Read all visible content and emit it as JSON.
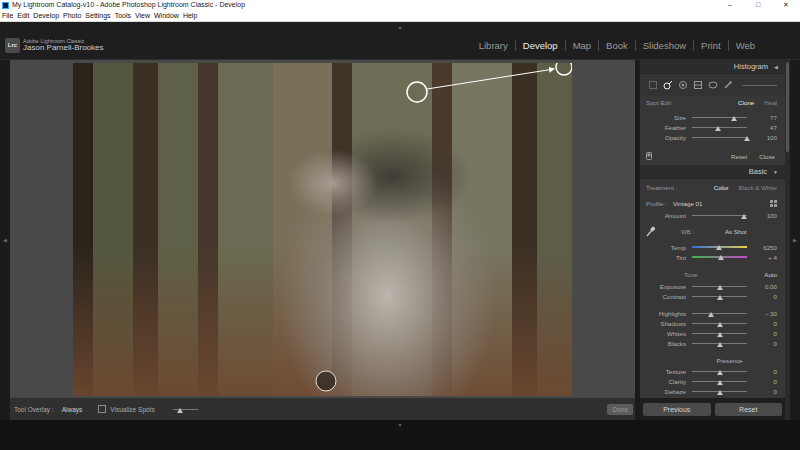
{
  "window": {
    "title": "My Lightroom Catalog-v10 - Adobe Photoshop Lightroom Classic - Develop",
    "controls": [
      "–",
      "□",
      "✕"
    ]
  },
  "menu": [
    "File",
    "Edit",
    "Develop",
    "Photo",
    "Settings",
    "Tools",
    "View",
    "Window",
    "Help"
  ],
  "identity": {
    "logo": "Lrc",
    "product": "Adobe Lightroom Classic",
    "user": "Jason Parnell-Brookes"
  },
  "modules": [
    {
      "label": "Library",
      "selected": false
    },
    {
      "label": "Develop",
      "selected": true
    },
    {
      "label": "Map",
      "selected": false
    },
    {
      "label": "Book",
      "selected": false
    },
    {
      "label": "Slideshow",
      "selected": false
    },
    {
      "label": "Print",
      "selected": false
    },
    {
      "label": "Web",
      "selected": false
    }
  ],
  "panel_toggles": {
    "top": "▲",
    "bottom": "▼",
    "left": "◀",
    "right": "▶"
  },
  "right_panel": {
    "histogram": {
      "title": "Histogram",
      "toggle": "◀"
    },
    "tools": [
      {
        "kind": "crop",
        "selected": false
      },
      {
        "kind": "spot",
        "selected": true
      },
      {
        "kind": "redeye",
        "selected": false
      },
      {
        "kind": "graduated",
        "selected": false
      },
      {
        "kind": "radial",
        "selected": false
      },
      {
        "kind": "brush",
        "selected": false
      }
    ],
    "spot_edit": {
      "label": "Spot Edit :",
      "modes": [
        {
          "label": "Clone",
          "selected": true
        },
        {
          "label": "Heal",
          "selected": false
        }
      ],
      "sliders": [
        {
          "label": "Size",
          "value": "77",
          "level": 0.77,
          "kind": "plain"
        },
        {
          "label": "Feather",
          "value": "47",
          "level": 0.47,
          "kind": "plain"
        },
        {
          "label": "Opacity",
          "value": "100",
          "level": 1.0,
          "kind": "plain"
        }
      ],
      "buttons": [
        "Reset",
        "Close"
      ]
    },
    "basic": {
      "title": "Basic",
      "toggle": "▼",
      "treatment": {
        "label": "Treatment :",
        "options": [
          {
            "label": "Color",
            "selected": true
          },
          {
            "label": "Black & White",
            "selected": false
          }
        ]
      },
      "profile": {
        "label": "Profile :",
        "value": "Vintage 01"
      },
      "amount": {
        "label": "Amount",
        "value": "100",
        "level": 0.95,
        "kind": "plain"
      },
      "wb": {
        "label": "WB :",
        "value": "As Shot"
      },
      "wb_sliders": [
        {
          "label": "Temp",
          "value": "6250",
          "level": 0.49,
          "kind": "temp"
        },
        {
          "label": "Tint",
          "value": "+ 4",
          "level": 0.52,
          "kind": "tint"
        }
      ],
      "tone": {
        "label": "Tone",
        "auto": "Auto"
      },
      "tone_sliders": [
        {
          "label": "Exposure",
          "value": "0.00",
          "level": 0.5,
          "kind": "plain"
        },
        {
          "label": "Contrast",
          "value": "0",
          "level": 0.5,
          "kind": "plain"
        }
      ],
      "range_sliders": [
        {
          "label": "Highlights",
          "value": "– 30",
          "level": 0.35,
          "kind": "plain"
        },
        {
          "label": "Shadows",
          "value": "0",
          "level": 0.5,
          "kind": "plain"
        },
        {
          "label": "Whites",
          "value": "0",
          "level": 0.5,
          "kind": "plain"
        },
        {
          "label": "Blacks",
          "value": "0",
          "level": 0.5,
          "kind": "plain"
        }
      ],
      "presence": {
        "label": "Presence"
      },
      "presence_sliders": [
        {
          "label": "Texture",
          "value": "0",
          "level": 0.5,
          "kind": "plain"
        },
        {
          "label": "Clarity",
          "value": "0",
          "level": 0.5,
          "kind": "plain"
        },
        {
          "label": "Dehaze",
          "value": "0",
          "level": 0.5,
          "kind": "plain"
        }
      ]
    },
    "buttons": [
      "Previous",
      "Reset"
    ]
  },
  "toolbar": {
    "overlay_label": "Tool Overlay :",
    "overlay_value": "Always",
    "visualize_spots": {
      "label": "Visualize Spots",
      "checked": false
    },
    "threshold_level": 0.3,
    "done": {
      "label": "Done",
      "disabled": true
    }
  }
}
